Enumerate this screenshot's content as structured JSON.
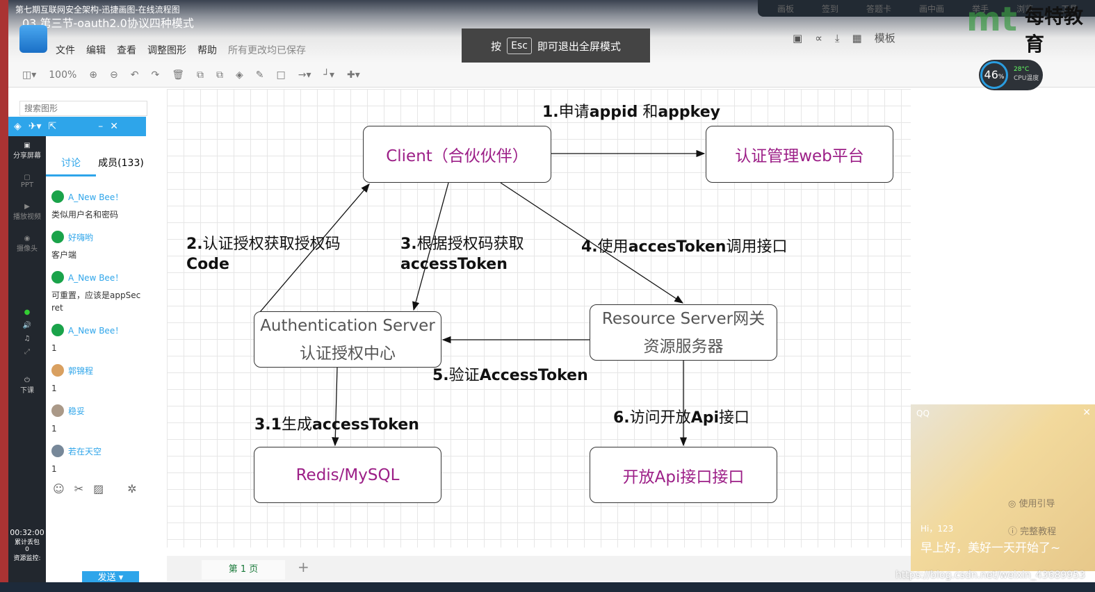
{
  "window": {
    "title": "第七期互联网安全架构-迅捷画图-在线流程图",
    "video_title": "03.第三节-oauth2.0协议四种模式"
  },
  "menu": {
    "items": [
      "文件",
      "编辑",
      "查看",
      "调整图形",
      "帮助"
    ],
    "status": "所有更改均已保存"
  },
  "esc_notice": {
    "prefix": "按",
    "key": "Esc",
    "suffix": "即可退出全屏模式"
  },
  "live_bar": {
    "items": [
      "画板",
      "签到",
      "答题卡",
      "画中画",
      "举手",
      "浏览",
      "工具"
    ]
  },
  "right_tools": {
    "template_label": "模板",
    "brand": "每特教育",
    "logo": "mt"
  },
  "toolbar": {
    "zoom": "100%"
  },
  "cpu": {
    "percent": "46",
    "unit": "%",
    "temp": "28°C",
    "label": "CPU温度"
  },
  "sidebar": {
    "search_placeholder": "搜索图形"
  },
  "chat": {
    "tabs": [
      "讨论",
      "成员(133)"
    ],
    "left_items": [
      "分享屏幕",
      "PPT",
      "播放视频",
      "摄像头",
      "下课"
    ],
    "messages": [
      {
        "user": "A_New Bee！",
        "text": "类似用户名和密码"
      },
      {
        "user": "好嗨哟",
        "text": "客户端"
      },
      {
        "user": "A_New Bee！",
        "text": "可重置，应该是appSecret"
      },
      {
        "user": "A_New Bee！",
        "text": "1"
      },
      {
        "user": "郭锦程",
        "text": "1"
      },
      {
        "user": "稳妥",
        "text": "1"
      },
      {
        "user": "若在天空",
        "text": "1"
      }
    ],
    "send_label": "发送",
    "timer": "00:32:00",
    "packet_loss_label": "累计丢包",
    "packet_loss": "0",
    "monitor_label": "资源监控:"
  },
  "diagram": {
    "nodes": {
      "client": "Client（合伙伙伴）",
      "web": "认证管理web平台",
      "auth_line1": "Authentication Server",
      "auth_line2": "认证授权中心",
      "res_line1": "Resource Server网关",
      "res_line2": "资源服务器",
      "redis": "Redis/MySQL",
      "api": "开放Api接口接口"
    },
    "labels": {
      "l1_num": "1.",
      "l1_a": "申请",
      "l1_b": "appid",
      "l1_c": " 和",
      "l1_d": "appkey",
      "l2_num": "2.",
      "l2_a": "认证授权获取授权码",
      "l2_b": "Code",
      "l3_num": "3.",
      "l3_a": "根据授权码获取",
      "l3_b": "accessToken",
      "l4_num": "4.",
      "l4_a": "使用",
      "l4_b": "accesToken",
      "l4_c": "调用接口",
      "l5_num": "5.",
      "l5_a": "验证",
      "l5_b": "AccessToken",
      "l31_num": "3.1",
      "l31_a": "生成",
      "l31_b": "accessToken",
      "l6_num": "6.",
      "l6_a": "访问开放",
      "l6_b": "Api",
      "l6_c": "接口"
    }
  },
  "pages": {
    "current": "第 1 页"
  },
  "popup": {
    "app": "QQ",
    "guide": "使用引导",
    "tutorial": "完整教程",
    "greeting": "Hi，123",
    "message": "早上好，美好一天开始了~"
  },
  "watermark": "https://blog.csdn.net/weixin_43689953"
}
